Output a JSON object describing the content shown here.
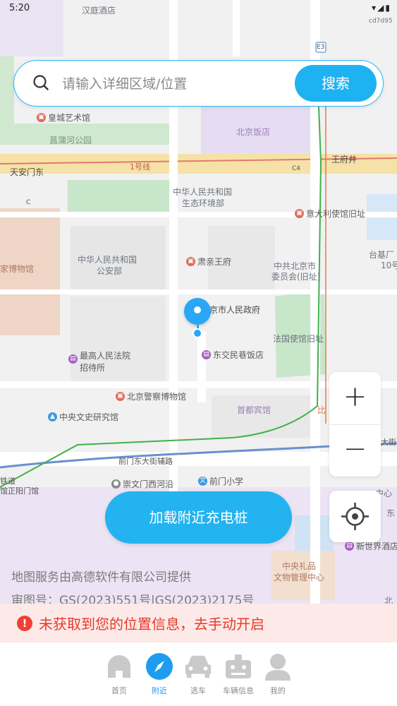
{
  "status_bar": {
    "time": "5:20",
    "icons": [
      "a-notification-icon",
      "wifi-icon",
      "signal-icon",
      "battery-icon"
    ]
  },
  "search": {
    "placeholder": "请输入详细区域/位置",
    "value": "",
    "button_label": "搜索"
  },
  "map": {
    "labels": {
      "top_hotel": "汉庭酒店",
      "corner_code": "cd7d95",
      "route_e3": "E3",
      "royal_art": "皇城艺术馆",
      "changpu_park": "菖蒲河公园",
      "tiananmen_east": "天安门东",
      "line1": "1号线",
      "wangfujing": "王府井",
      "c4": "C4",
      "c_marker": "C",
      "beijing_hotel": "北京饭店",
      "ministry_env": "中华人民共和国生态环境部",
      "ministry_env_l1": "中华人民共和国",
      "ministry_env_l2": "生态环境部",
      "italian_legation": "意大利使馆旧址",
      "museum": "家博物馆",
      "ministry_security_l1": "中华人民共和国",
      "ministry_security_l2": "公安部",
      "suqin_mansion": "肃亲王府",
      "party_committee_l1": "中共北京市",
      "party_committee_l2": "委员会(旧址)",
      "taiji": "台基厂",
      "no10": "10号",
      "city_gov": "京市人民政府",
      "french_legation": "法国使馆旧址",
      "court_hostel_l1": "最高人民法院",
      "court_hostel_l2": "招待所",
      "dongjiao_hotel": "东交民巷饭店",
      "police_museum": "北京警察博物馆",
      "capital_hotel": "首都宾馆",
      "central_doc": "中央文史研究馆",
      "bi": "比",
      "dajie": "大街",
      "qianmen_east": "前门东大街辅路",
      "railway": "铁道",
      "zhengyangmen": "馆正阳门馆",
      "chongwenmen": "崇文门西河沿",
      "qianmen_school": "前门小学",
      "gift_office_l1": "中央礼品",
      "gift_office_l2": "文物管理中心",
      "new_world": "新世界酒店",
      "center": "中心",
      "east": "东",
      "north": "北"
    }
  },
  "controls": {
    "zoom_in": "+",
    "zoom_out": "−"
  },
  "load_button_label": "加载附近充电桩",
  "attribution": {
    "provider": "地图服务由高德软件有限公司提供",
    "review": "审图号：GS(2023)551号|GS(2023)2175号"
  },
  "warning": {
    "icon": "!",
    "text": "未获取到您的位置信息，去手动开启"
  },
  "tabs": [
    {
      "label": "首页",
      "icon": "home-icon",
      "active": false
    },
    {
      "label": "附近",
      "icon": "compass-icon",
      "active": true
    },
    {
      "label": "选车",
      "icon": "car-icon",
      "active": false
    },
    {
      "label": "车辆信息",
      "icon": "vehicle-info-icon",
      "active": false
    },
    {
      "label": "我的",
      "icon": "profile-icon",
      "active": false
    }
  ],
  "colors": {
    "accent": "#1fb2f2",
    "active_tab": "#2196f3",
    "warning": "#e8392c",
    "warning_bg": "#fde9e7"
  }
}
